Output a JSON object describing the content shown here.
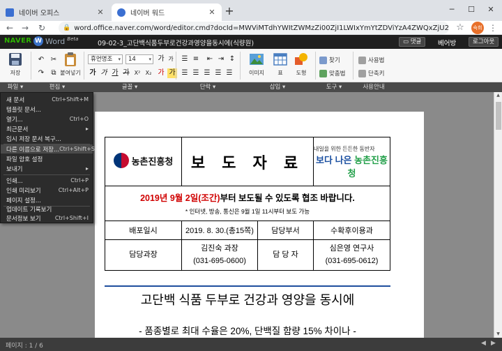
{
  "browser": {
    "tabs": [
      {
        "title": "네이버 오피스",
        "color": "#3b6fd1"
      },
      {
        "title": "네이버 워드",
        "color": "#3b6fd1"
      }
    ],
    "url": "word.office.naver.com/word/editor.cmd?docId=MWViMTdhYWItZWMzZi00ZjI1LWIxYmYtZDViYzA4ZWQxZjU2&baseFolder=%252F",
    "profile_label": "숙희"
  },
  "app": {
    "brand": "NAVER",
    "product": "Word",
    "beta": "Beta",
    "doc_title": "09-02-3_고단백식품두부로건강과영양을동시에(식량원)",
    "reply_btn": "댓글",
    "username": "베어방",
    "logout_btn": "로그아웃"
  },
  "ribbon": {
    "save": "저장",
    "paste": "붙여넣기",
    "font_name": "휴먼명조",
    "font_size": "14",
    "image": "이미지",
    "table": "표",
    "shape": "도형",
    "find": "찾기",
    "spell": "맞춤법",
    "user_guide": "사용법",
    "shortcut": "단축키",
    "groups": [
      "파일",
      "편집",
      "글꼴",
      "단락",
      "삽입",
      "도구",
      "사용안내"
    ]
  },
  "file_menu": [
    {
      "label": "새 문서",
      "shortcut": "Ctrl+Shift+M"
    },
    {
      "label": "템플릿 문서...",
      "shortcut": ""
    },
    {
      "label": "열기...",
      "shortcut": "Ctrl+O"
    },
    {
      "label": "최근문서",
      "shortcut": "▸"
    },
    {
      "label": "임시 저장 문서 복구...",
      "shortcut": ""
    },
    {
      "label": "다른 이름으로 저장...",
      "shortcut": "Ctrl+Shift+S"
    },
    {
      "label": "파일 암호 설정",
      "shortcut": ""
    },
    {
      "label": "보내기",
      "shortcut": "▸"
    },
    {
      "label": "인쇄...",
      "shortcut": "Ctrl+P"
    },
    {
      "label": "인쇄 미리보기",
      "shortcut": "Ctrl+Alt+P"
    },
    {
      "label": "페이지 설정...",
      "shortcut": ""
    },
    {
      "label": "업데이트 기록보기",
      "shortcut": ""
    },
    {
      "label": "문서정보 보기",
      "shortcut": "Ctrl+Shift+I"
    }
  ],
  "document": {
    "org_name": "농촌진흥청",
    "headline": "보 도 자 료",
    "slogan_small": "내일을 위한 든든한 동반자",
    "slogan_big_a": "보다 나은",
    "slogan_big_b": "농촌진흥청",
    "notice_red": "2019년 9월 2일(조간)",
    "notice_rest": "부터 보도될 수 있도록 협조 바랍니다.",
    "notice_sub": "* 인터넷, 방송, 통신은 9월 1일 11시부터 보도 가능",
    "dist_date_label": "배포일시",
    "dist_date_value": "2019. 8. 30.(총15쪽)",
    "dept_label": "담당부서",
    "dept_value": "수확후이용과",
    "manager_label": "담당과장",
    "manager_name": "김진숙 과장",
    "manager_phone": "(031-695-0600)",
    "contact_label": "담 당 자",
    "contact_name": "심은영 연구사",
    "contact_phone": "(031-695-0612)",
    "heading": "고단백 식품 두부로 건강과 영양을 동시에",
    "subheading": "- 품종별로 최대 수율은 20%, 단백질 함량 15% 차이나 -"
  },
  "status": {
    "page": "페이지 : 1 / 6"
  },
  "colors": {
    "notice_red": "#d00000",
    "rule_blue": "#1f4e9e",
    "menu_bg": "#2c2c2c",
    "naver_green": "#2db400"
  }
}
